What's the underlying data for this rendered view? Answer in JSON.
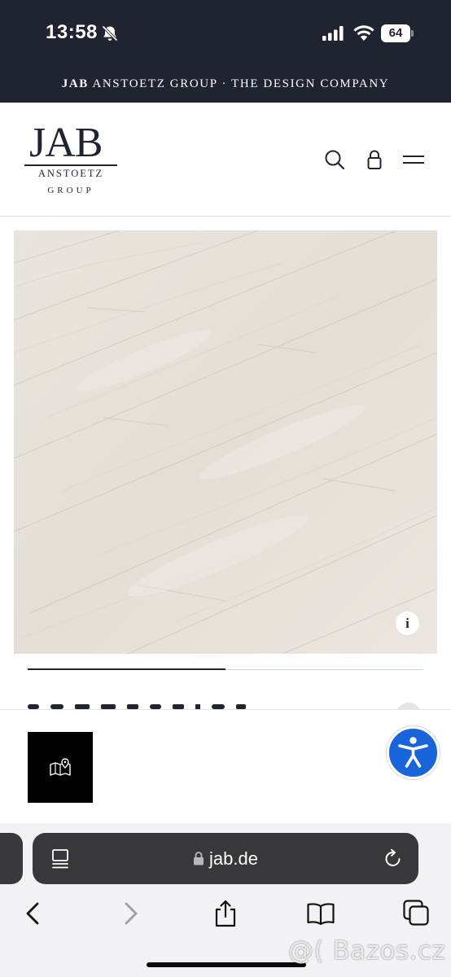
{
  "status_bar": {
    "time": "13:58",
    "battery_level": "64",
    "icons": [
      "bell-slash-icon",
      "cellular-signal-icon",
      "wifi-icon",
      "battery-icon"
    ]
  },
  "banner": {
    "brand": "JAB",
    "text": "ANSTOETZ GROUP · THE DESIGN COMPANY"
  },
  "header": {
    "logo": {
      "wordmark": "JAB",
      "line2": "ANSTOETZ",
      "line3": "GROUP"
    },
    "icons": [
      "search-icon",
      "lock-icon",
      "menu-icon"
    ]
  },
  "product": {
    "image": "light whitewashed oak plank flooring",
    "info_label": "i"
  },
  "gallery": {
    "progress": 0.5
  },
  "sticky_bar": {
    "icons": [
      "map-pin-icon",
      "accessibility-icon"
    ]
  },
  "browser": {
    "url": "jab.de",
    "icons": [
      "reader-icon",
      "url-lock-icon",
      "reload-icon",
      "back-icon",
      "forward-icon",
      "share-icon",
      "bookmarks-icon",
      "tabs-icon"
    ]
  },
  "watermark": "@( Bazos.cz",
  "colors": {
    "dark_navy": "#1f2430",
    "accessibility_blue": "#1864d9",
    "floor_tone": "#e6e0d8",
    "safari_bar": "#38383a"
  }
}
